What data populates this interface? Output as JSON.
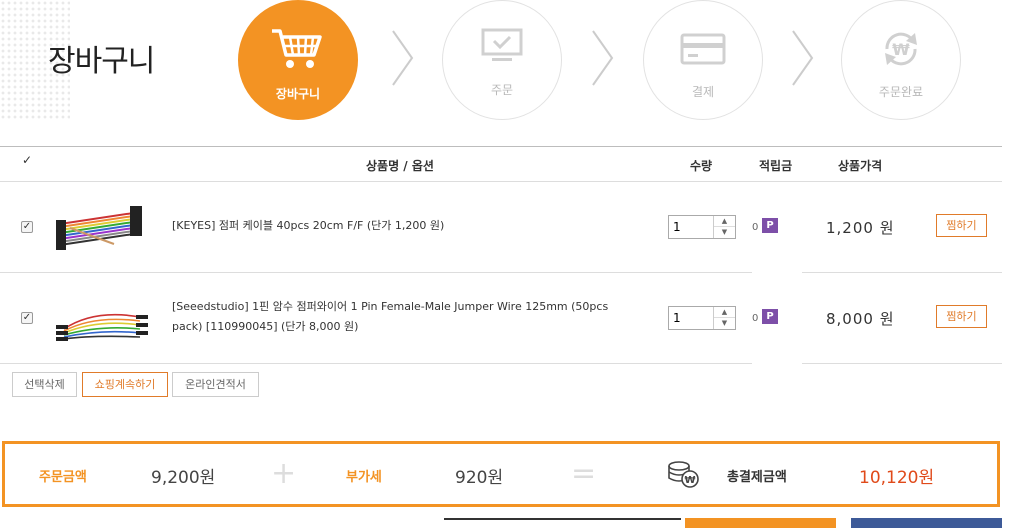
{
  "page": {
    "title": "장바구니"
  },
  "steps": [
    {
      "label": "장바구니",
      "icon": "cart-icon",
      "active": true
    },
    {
      "label": "주문",
      "icon": "monitor-check-icon",
      "active": false
    },
    {
      "label": "결제",
      "icon": "card-icon",
      "active": false
    },
    {
      "label": "주문완료",
      "icon": "won-refresh-icon",
      "active": false
    }
  ],
  "table": {
    "headers": {
      "select": "✓",
      "name": "상품명 / 옵션",
      "qty": "수량",
      "points": "적립금",
      "price": "상품가격"
    },
    "rows": [
      {
        "name": "[KEYES] 점퍼 케이블 40pcs 20cm F/F (단가 1,200 원)",
        "qty": "1",
        "points": "0",
        "point_badge": "P",
        "price": "1,200 원",
        "wish": "찜하기",
        "checked": true
      },
      {
        "name_line1": "[Seeedstudio] 1핀 암수 점퍼와이어 1 Pin Female-Male Jumper Wire 125mm (50pcs",
        "name_line2": "pack) [110990045] (단가 8,000 원)",
        "qty": "1",
        "points": "0",
        "point_badge": "P",
        "price": "8,000 원",
        "wish": "찜하기",
        "checked": true
      }
    ]
  },
  "actions": {
    "delete_selected": "선택삭제",
    "continue_shopping": "쇼핑계속하기",
    "online_quote": "온라인견적서"
  },
  "summary": {
    "order_label": "주문금액",
    "order_value": "9,200원",
    "plus": "+",
    "vat_label": "부가세",
    "vat_value": "920원",
    "equals": "=",
    "total_icon": "coins-icon",
    "total_label": "총결제금액",
    "total_value": "10,120원"
  },
  "colors": {
    "accent": "#f39323",
    "total": "#e04a1a",
    "point_badge": "#7d4fa8",
    "blue": "#3d5a98"
  }
}
